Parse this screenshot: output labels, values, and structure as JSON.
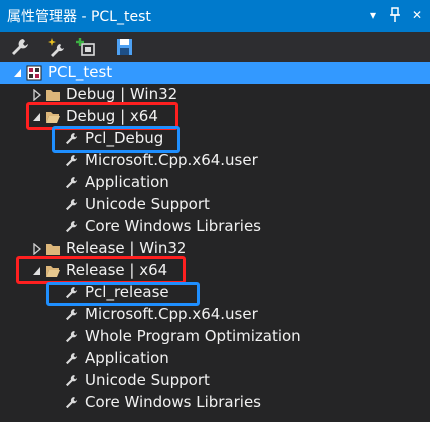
{
  "window": {
    "title": "属性管理器 - PCL_test",
    "dropdown_glyph": "▾",
    "pin_glyph": "📌",
    "close_glyph": "✕"
  },
  "toolbar": {
    "buttons": [
      "properties-icon",
      "add-new-property-sheet-icon",
      "add-existing-property-sheet-icon",
      "save-icon"
    ]
  },
  "tree": {
    "project": "PCL_test",
    "debug_win32": "Debug | Win32",
    "debug_x64": "Debug | x64",
    "pcl_debug": "Pcl_Debug",
    "dbg_cpp_user": "Microsoft.Cpp.x64.user",
    "dbg_application": "Application",
    "dbg_unicode": "Unicode Support",
    "dbg_core_windows": "Core Windows Libraries",
    "release_win32": "Release | Win32",
    "release_x64": "Release | x64",
    "pcl_release": "Pcl_release",
    "rel_cpp_user": "Microsoft.Cpp.x64.user",
    "rel_whole_program": "Whole Program Optimization",
    "rel_application": "Application",
    "rel_unicode": "Unicode Support",
    "rel_core_windows": "Core Windows Libraries"
  },
  "colors": {
    "accent": "#007acc",
    "selection": "#3399ff",
    "annotation_red": "#ff2020",
    "annotation_blue": "#1f8fff"
  }
}
